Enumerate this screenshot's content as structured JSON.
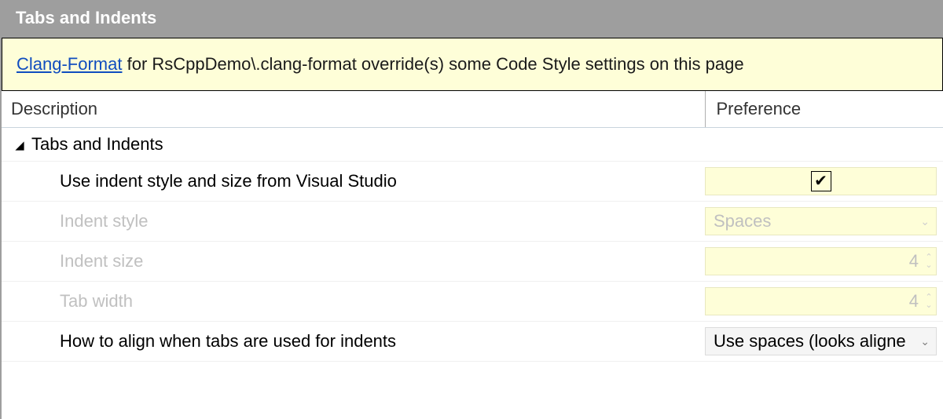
{
  "panel": {
    "title": "Tabs and Indents"
  },
  "notice": {
    "link_text": "Clang-Format",
    "rest_text": " for RsCppDemo\\.clang-format override(s) some Code Style settings on this page"
  },
  "columns": {
    "description": "Description",
    "preference": "Preference"
  },
  "group": {
    "label": "Tabs and Indents",
    "expanded": true
  },
  "rows": {
    "use_vs": {
      "label": "Use indent style and size from Visual Studio",
      "checked": true,
      "disabled": false
    },
    "indent_style": {
      "label": "Indent style",
      "value": "Spaces",
      "disabled": true
    },
    "indent_size": {
      "label": "Indent size",
      "value": "4",
      "disabled": true
    },
    "tab_width": {
      "label": "Tab width",
      "value": "4",
      "disabled": true
    },
    "align_tabs": {
      "label": "How to align when tabs are used for indents",
      "value": "Use spaces (looks aligne",
      "disabled": false
    }
  }
}
